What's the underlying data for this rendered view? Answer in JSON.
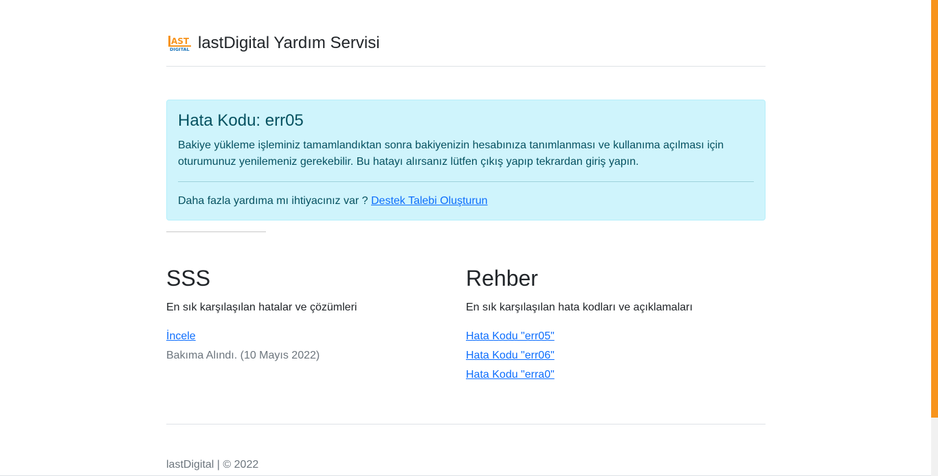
{
  "header": {
    "logo_icon": "lastdigital-logo",
    "title": "lastDigital Yardım Servisi"
  },
  "alert": {
    "heading": "Hata Kodu: err05",
    "message": "Bakiye yükleme işleminiz tamamlandıktan sonra bakiyenizin hesabınıza tanımlanması ve kullanıma açılması için oturumunuz yenilemeniz gerekebilir. Bu hatayı alırsanız lütfen çıkış yapıp tekrardan giriş yapın.",
    "help_prefix": "Daha fazla yardıma mı ihtiyacınız var ? ",
    "help_link": "Destek Talebi Oluşturun"
  },
  "faq": {
    "title": "SSS",
    "description": "En sık karşılaşılan hatalar ve çözümleri",
    "link": "İncele",
    "note": "Bakıma Alındı. (10 Mayıs 2022)"
  },
  "guide": {
    "title": "Rehber",
    "description": "En sık karşılaşılan hata kodları ve açıklamaları",
    "links": [
      "Hata Kodu \"err05\"",
      "Hata Kodu \"err06\"",
      "Hata Kodu \"erra0\""
    ]
  },
  "footer": {
    "text": "lastDigital | © 2022"
  },
  "colors": {
    "accent": "#f7941d",
    "link": "#0d6efd",
    "alert_bg": "#cff4fc",
    "alert_text": "#055160"
  }
}
